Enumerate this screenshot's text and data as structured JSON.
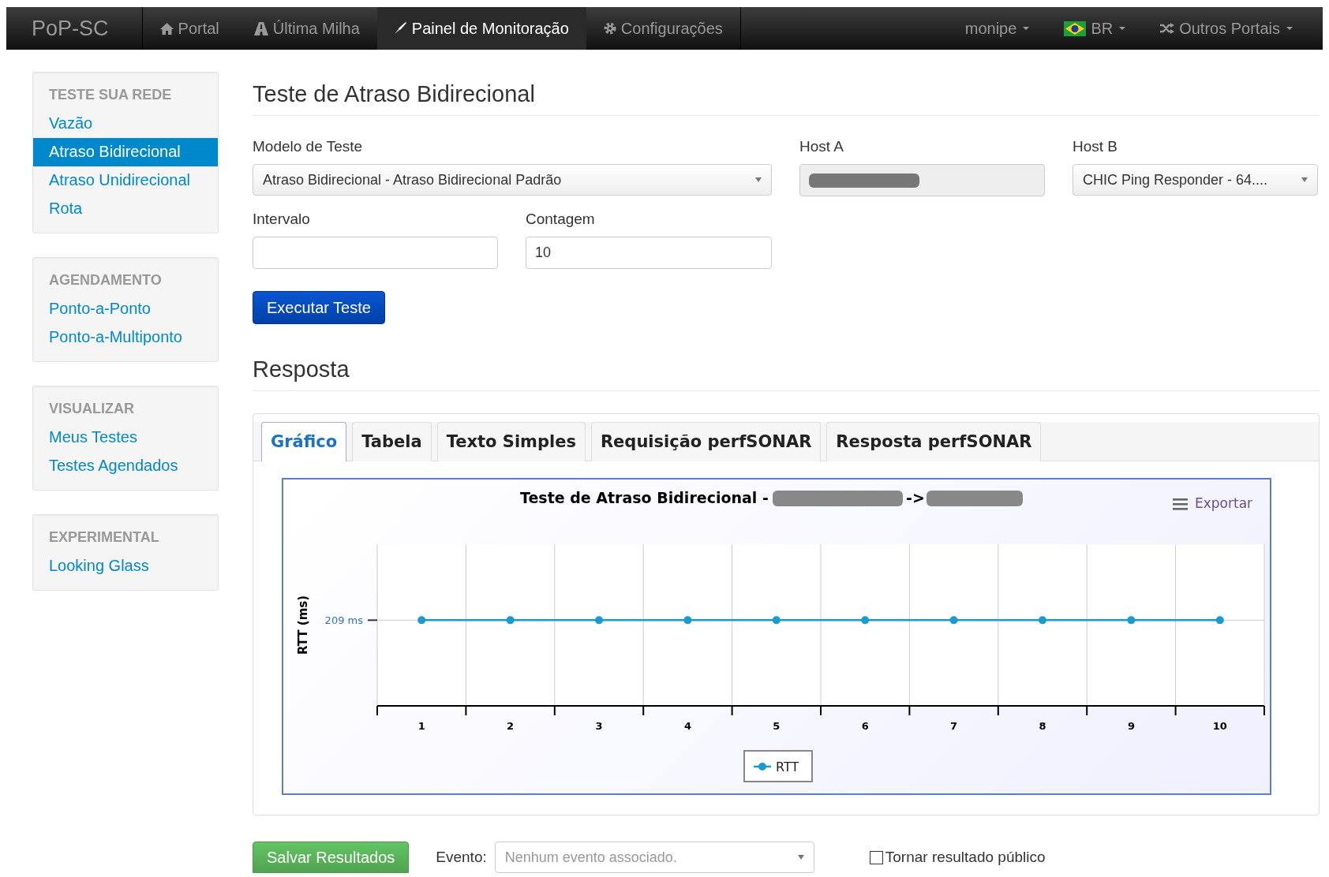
{
  "navbar": {
    "brand": "PoP-SC",
    "items": [
      {
        "label": "Portal",
        "selected": false
      },
      {
        "label": "Última Milha",
        "selected": false
      },
      {
        "label": "Painel de Monitoração",
        "selected": true
      },
      {
        "label": "Configurações",
        "selected": false
      }
    ],
    "right_items": [
      {
        "label": "monipe"
      },
      {
        "label": "BR"
      },
      {
        "label": "Outros Portais"
      }
    ]
  },
  "sidebar": {
    "sections": [
      {
        "heading": "TESTE SUA REDE",
        "items": [
          {
            "label": "Vazão",
            "selected": false
          },
          {
            "label": "Atraso Bidirecional",
            "selected": true
          },
          {
            "label": "Atraso Unidirecional",
            "selected": false
          },
          {
            "label": "Rota",
            "selected": false
          }
        ]
      },
      {
        "heading": "AGENDAMENTO",
        "items": [
          {
            "label": "Ponto-a-Ponto",
            "selected": false
          },
          {
            "label": "Ponto-a-Multiponto",
            "selected": false
          }
        ]
      },
      {
        "heading": "VISUALIZAR",
        "items": [
          {
            "label": "Meus Testes",
            "selected": false
          },
          {
            "label": "Testes Agendados",
            "selected": false
          }
        ]
      },
      {
        "heading": "EXPERIMENTAL",
        "items": [
          {
            "label": "Looking Glass",
            "selected": false
          }
        ]
      }
    ]
  },
  "page_title": "Teste de Atraso Bidirecional",
  "form": {
    "modelo": {
      "label": "Modelo de Teste",
      "value": "Atraso Bidirecional - Atraso Bidirecional Padrão"
    },
    "host_a": {
      "label": "Host A",
      "disabled": true
    },
    "host_b": {
      "label": "Host B",
      "value": "CHIC Ping Responder - 64...."
    },
    "intervalo": {
      "label": "Intervalo"
    },
    "contagem": {
      "label": "Contagem",
      "value": "10"
    },
    "run_button": "Executar Teste"
  },
  "response": {
    "heading": "Resposta",
    "tabs": [
      {
        "label": "Gráfico",
        "selected": true
      },
      {
        "label": "Tabela",
        "selected": false
      },
      {
        "label": "Texto Simples",
        "selected": false
      },
      {
        "label": "Requisição perfSONAR",
        "selected": false
      },
      {
        "label": "Resposta perfSONAR",
        "selected": false
      }
    ],
    "export_label": "Exportar",
    "chart": {
      "title": "Teste de Atraso Bidirecional -",
      "title_arrow": "->",
      "y_axis_title": "RTT (ms)",
      "y_label": "209 ms",
      "x_labels": [
        "1",
        "2",
        "3",
        "4",
        "5",
        "6",
        "7",
        "8",
        "9",
        "10"
      ],
      "legend": "RTT"
    }
  },
  "footer": {
    "save_button": "Salvar Resultados",
    "evento_label": "Evento:",
    "evento_placeholder": "Nenhum evento associado.",
    "public_checkbox": {
      "label": "Tornar resultado público",
      "checked": false
    }
  }
}
